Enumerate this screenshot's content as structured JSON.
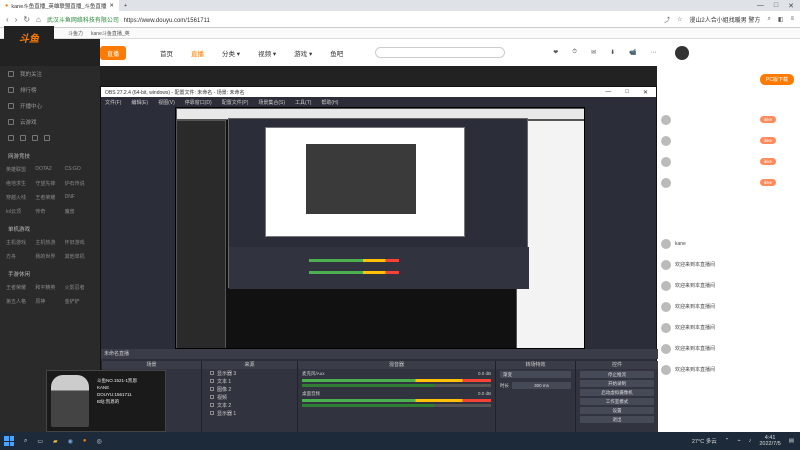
{
  "browser": {
    "tabs": [
      {
        "label": "kane斗鱼直播_英雄联盟直播_斗鱼直播",
        "active": true
      },
      {
        "label": "+",
        "active": false
      }
    ],
    "url_scheme": "https://",
    "url": "www.douyu.com/1561711",
    "secure_label": "武汉斗鱼网络科技有限公司",
    "search_hint": "漫山2人合小姐找暖男 警方",
    "controls": [
      "—",
      "□",
      "✕"
    ]
  },
  "bookmarks": [
    "斗鱼力",
    "kane斗鱼直播_英"
  ],
  "site": {
    "logo": "斗鱼",
    "logo_sub": "DOUYU.COM",
    "small_logo": "直播",
    "nav": [
      {
        "label": "首页",
        "active": false
      },
      {
        "label": "直播",
        "active": true
      },
      {
        "label": "分类 ▾",
        "active": false
      },
      {
        "label": "视频 ▾",
        "active": false
      },
      {
        "label": "游戏 ▾",
        "active": false
      },
      {
        "label": "鱼吧",
        "active": false
      }
    ],
    "search_placeholder": "",
    "header_icons": [
      "❤",
      "⏱",
      "✉",
      "⬇",
      "📹",
      "⋯"
    ]
  },
  "sidebar": {
    "items": [
      "我的关注",
      "排行榜",
      "开播中心",
      "云游戏"
    ],
    "section1": "网游竞技",
    "grid1": [
      "英雄联盟",
      "DOTA2",
      "CS:GO",
      "绝地求生",
      "守望先锋",
      "炉石传说",
      "穿越火线",
      "王者荣耀",
      "DNF",
      "lol云顶",
      "传奇",
      "魔兽"
    ],
    "section2": "单机游戏",
    "grid2": [
      "主机游戏",
      "主机热游",
      "怀旧游戏",
      "方舟",
      "我的世界",
      "其他单机"
    ],
    "section3": "手游休闲",
    "grid3": [
      "王者荣耀",
      "和平精英",
      "火影忍者",
      "第五人格",
      "原神",
      "金铲铲"
    ]
  },
  "chat": {
    "button": "PC版下载",
    "lines": [
      {
        "user": "",
        "badge": "ikke"
      },
      {
        "user": "",
        "badge": "ikke"
      },
      {
        "user": "",
        "badge": "ikke"
      },
      {
        "user": "",
        "badge": "ikke"
      },
      {
        "user": "kane",
        "badge": ""
      },
      {
        "user": "欢迎来到本直播间",
        "badge": ""
      },
      {
        "user": "欢迎来到本直播间",
        "badge": ""
      },
      {
        "user": "欢迎来到本直播间",
        "badge": ""
      },
      {
        "user": "欢迎来到本直播间",
        "badge": ""
      },
      {
        "user": "欢迎来到本直播间",
        "badge": ""
      },
      {
        "user": "欢迎来到本直播间",
        "badge": ""
      }
    ]
  },
  "obs": {
    "title": "OBS 27.2.4 (64-bit, windows) - 配置文件: 未命名 - 场景: 未命名",
    "window_controls": [
      "—",
      "□",
      "✕"
    ],
    "menu": [
      "文件(F)",
      "编辑(E)",
      "视图(V)",
      "停靠窗口(D)",
      "配置文件(P)",
      "场景集合(S)",
      "工具(T)",
      "帮助(H)"
    ],
    "scene_label": "未命名直播",
    "docks": {
      "scenes": "场景",
      "sources": "来源",
      "mixer": "混音器",
      "transitions": "转场特效",
      "controls": "控件"
    },
    "source_rows": [
      "显示器 3",
      "文本 1",
      "图像 2",
      "视频",
      "文本 2",
      "显示器 1"
    ],
    "mixer": [
      {
        "name": "麦克风/Aux",
        "db": "0.0 dB"
      },
      {
        "name": "桌面音频",
        "db": "0.0 dB"
      }
    ],
    "transition": {
      "type": "渐变",
      "duration_label": "时长",
      "duration": "300 ms"
    },
    "control_buttons": [
      "停止推流",
      "开始录制",
      "启动虚拟摄像机",
      "工作室模式",
      "设置",
      "退出"
    ]
  },
  "cam": {
    "lines": [
      "斗鱼NO.1521-1凯恩",
      "KANE",
      "DOUYU:1561711",
      "B站:凯恩的"
    ]
  },
  "taskbar": {
    "weather": "27°C 多云",
    "time": "4:41",
    "date": "2022/7/5"
  }
}
